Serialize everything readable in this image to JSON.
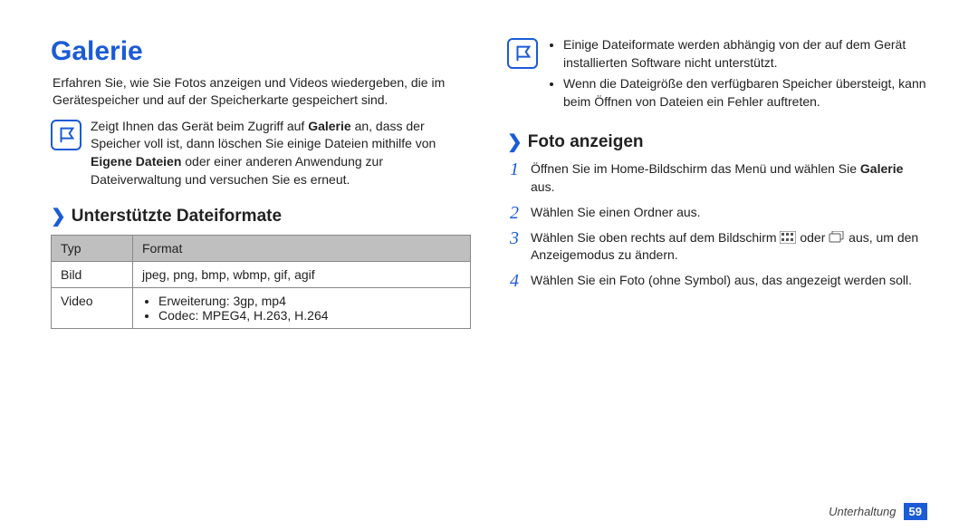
{
  "title": "Galerie",
  "intro": "Erfahren Sie, wie Sie Fotos anzeigen und Videos wiedergeben, die im Gerätespeicher und auf der Speicherkarte gespeichert sind.",
  "note1_parts": [
    "Zeigt Ihnen das Gerät beim Zugriff auf ",
    "Galerie",
    " an, dass der Speicher voll ist, dann löschen Sie einige Dateien mithilfe von ",
    "Eigene Dateien",
    " oder einer anderen Anwendung zur Dateiverwaltung und versuchen Sie es erneut."
  ],
  "section_formats": "Unterstützte Dateiformate",
  "table": {
    "head_type": "Typ",
    "head_format": "Format",
    "row_image_type": "Bild",
    "row_image_format": "jpeg, png, bmp, wbmp, gif, agif",
    "row_video_type": "Video",
    "row_video_ext": "Erweiterung: 3gp, mp4",
    "row_video_codec": "Codec: MPEG4, H.263, H.264"
  },
  "note2_items": [
    "Einige Dateiformate werden abhängig von der auf dem Gerät installierten Software nicht unterstützt.",
    "Wenn die Dateigröße den verfügbaren Speicher übersteigt, kann beim Öffnen von Dateien ein Fehler auftreten."
  ],
  "section_view": "Foto anzeigen",
  "steps": {
    "s1_pre": "Öffnen Sie im Home-Bildschirm das Menü und wählen Sie ",
    "s1_bold": "Galerie",
    "s1_post": " aus.",
    "s2": "Wählen Sie einen Ordner aus.",
    "s3_pre": "Wählen Sie oben rechts auf dem Bildschirm ",
    "s3_mid": " oder ",
    "s3_post": " aus, um den Anzeigemodus zu ändern.",
    "s4": "Wählen Sie ein Foto (ohne Symbol) aus, das angezeigt werden soll."
  },
  "footer_label": "Unterhaltung",
  "page_number": "59",
  "nums": {
    "n1": "1",
    "n2": "2",
    "n3": "3",
    "n4": "4"
  }
}
